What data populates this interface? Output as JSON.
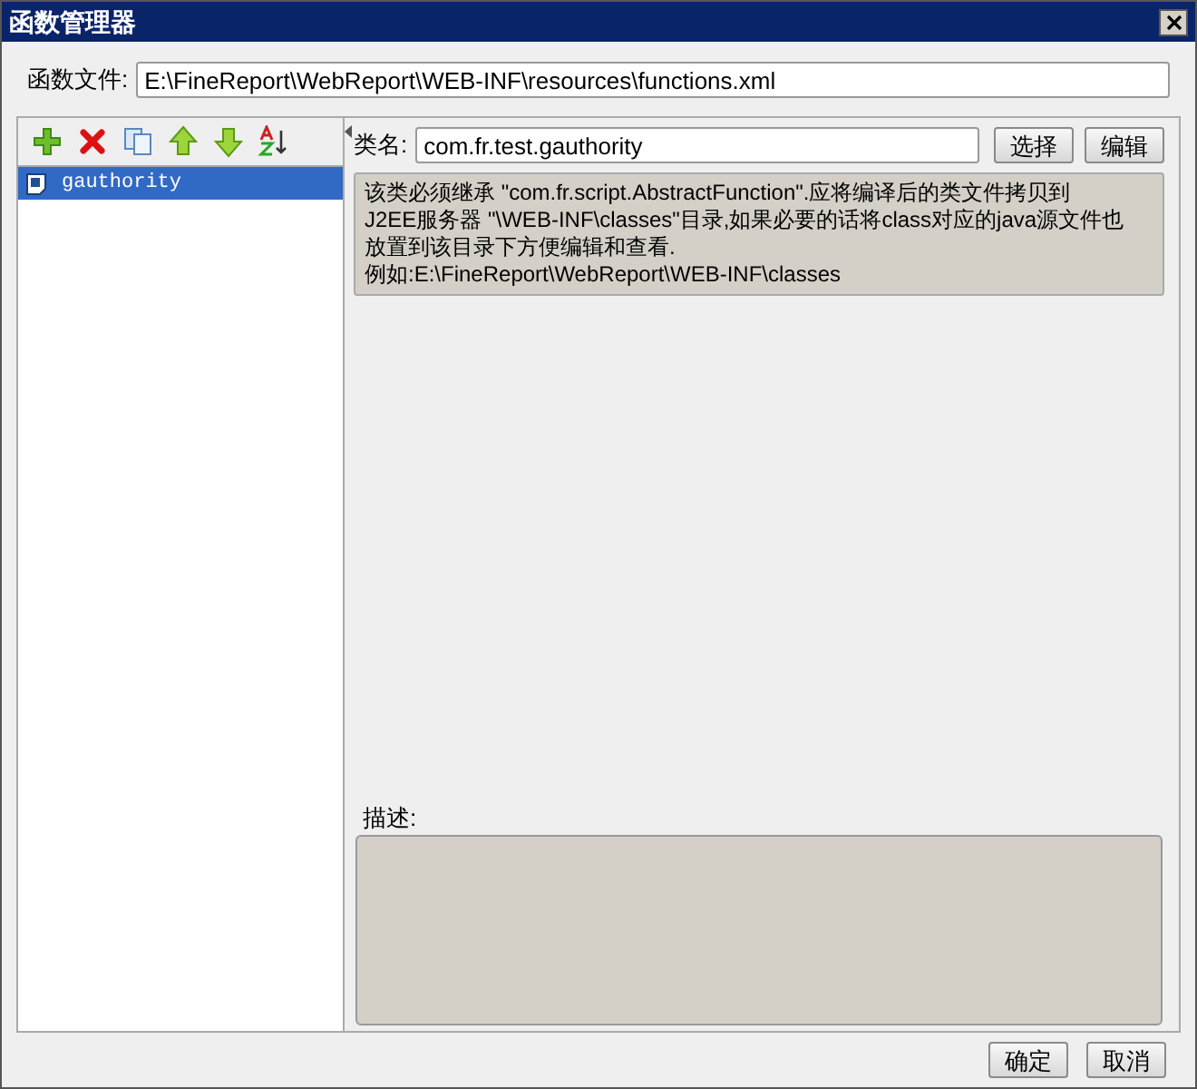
{
  "window": {
    "title": "函数管理器"
  },
  "file": {
    "label": "函数文件:",
    "value": "E:\\FineReport\\WebReport\\WEB-INF\\resources\\functions.xml"
  },
  "toolbar": [
    {
      "kind": "add"
    },
    {
      "kind": "delete"
    },
    {
      "kind": "copy"
    },
    {
      "kind": "up"
    },
    {
      "kind": "down"
    },
    {
      "kind": "sort"
    }
  ],
  "functions": [
    {
      "name": "gauthority",
      "selected": true
    }
  ],
  "class_name": {
    "label": "类名:",
    "value": "com.fr.test.gauthority",
    "buttons": [
      "选择",
      "编辑"
    ]
  },
  "note": [
    "该类必须继承 \"com.fr.script.AbstractFunction\".应将编译后的类文件拷贝到",
    "J2EE服务器 \"\\WEB-INF\\classes\"目录,如果必要的话将class对应的java源文件也",
    "放置到该目录下方便编辑和查看.",
    "例如:E:\\FineReport\\WebReport\\WEB-INF\\classes"
  ],
  "description": {
    "label": "描述:"
  },
  "buttons": [
    "确定",
    "取消"
  ]
}
